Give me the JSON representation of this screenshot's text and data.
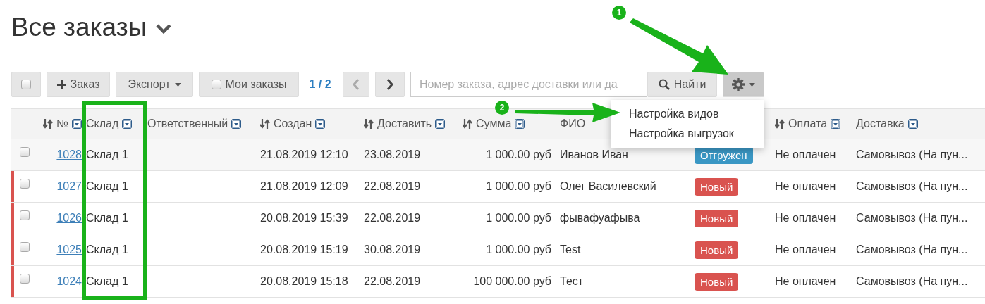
{
  "title": "Все заказы",
  "toolbar": {
    "select_all": {
      "checked": false
    },
    "add_button": "Заказ",
    "export_button": "Экспорт",
    "my_orders": {
      "label": "Мои заказы",
      "checked": false
    },
    "pager": "1 / 2",
    "search": {
      "placeholder": "Номер заказа, адрес доставки или да"
    },
    "find_button": "Найти",
    "settings": {
      "expanded": true
    }
  },
  "settings_menu": [
    "Настройка видов",
    "Настройка выгрузок"
  ],
  "table": {
    "columns": [
      {
        "label": "№",
        "sortable": true,
        "filterable": true
      },
      {
        "label": "Склад",
        "sortable": false,
        "filterable": true
      },
      {
        "label": "Ответственный",
        "sortable": false,
        "filterable": true
      },
      {
        "label": "Создан",
        "sortable": true,
        "filterable": true
      },
      {
        "label": "Доставить",
        "sortable": true,
        "filterable": true
      },
      {
        "label": "Сумма",
        "sortable": true,
        "filterable": true
      },
      {
        "label": "ФИО",
        "sortable": false,
        "filterable": false
      },
      {
        "label": "Оплата",
        "sortable": true,
        "filterable": true
      },
      {
        "label": "Доставка",
        "sortable": false,
        "filterable": true
      }
    ],
    "rows": [
      {
        "checked": false,
        "flagged": false,
        "highlighted": true,
        "number": "1028",
        "warehouse": "Склад 1",
        "created": "21.08.2019 12:10",
        "deliver": "23.08.2019",
        "sum": "1 000.00 руб",
        "name": "Иванов Иван",
        "status": {
          "label": "Отгружен",
          "color": "#3a97c4"
        },
        "payment": "Не оплачен",
        "delivery": "Самовывоз (На пун..."
      },
      {
        "checked": false,
        "flagged": true,
        "highlighted": false,
        "number": "1027",
        "warehouse": "Склад 1",
        "created": "21.08.2019 12:09",
        "deliver": "22.08.2019",
        "sum": "1 000.00 руб",
        "name": "Олег Василевский",
        "status": {
          "label": "Новый",
          "color": "#d9534f"
        },
        "payment": "Не оплачен",
        "delivery": "Самовывоз (На пун..."
      },
      {
        "checked": false,
        "flagged": true,
        "highlighted": false,
        "number": "1026",
        "warehouse": "Склад 1",
        "created": "20.08.2019 15:39",
        "deliver": "22.08.2019",
        "sum": "1 000.00 руб",
        "name": "фывафуафыва",
        "status": {
          "label": "Новый",
          "color": "#d9534f"
        },
        "payment": "Не оплачен",
        "delivery": "Самовывоз (На пун..."
      },
      {
        "checked": false,
        "flagged": true,
        "highlighted": false,
        "number": "1025",
        "warehouse": "Склад 1",
        "created": "20.08.2019 15:19",
        "deliver": "30.08.2019",
        "sum": "1 000.00 руб",
        "name": "Test",
        "status": {
          "label": "Новый",
          "color": "#d9534f"
        },
        "payment": "Не оплачен",
        "delivery": "Самовывоз (На пун..."
      },
      {
        "checked": false,
        "flagged": true,
        "highlighted": false,
        "number": "1024",
        "warehouse": "Склад 1",
        "created": "20.08.2019 15:18",
        "deliver": "22.08.2019",
        "sum": "100 000.00 руб",
        "name": "Тест",
        "status": {
          "label": "Новый",
          "color": "#d9534f"
        },
        "payment": "Не оплачен",
        "delivery": "Самовывоз (На пун..."
      }
    ]
  },
  "annotations": [
    {
      "label": "1"
    },
    {
      "label": "2"
    }
  ]
}
